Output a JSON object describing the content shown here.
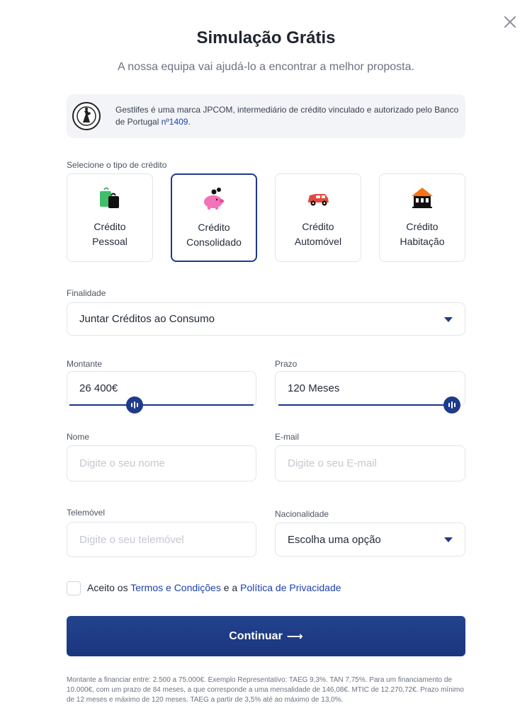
{
  "header": {
    "title": "Simulação Grátis",
    "subtitle": "A nossa equipa vai ajudá-lo a encontrar a melhor proposta."
  },
  "notice": {
    "text_before": "Gestlifes é uma marca JPCOM, intermediário de crédito vinculado e autorizado pelo Banco de Portugal ",
    "link": "nº1409",
    "text_after": "."
  },
  "credit_type": {
    "label": "Selecione o tipo de crédito",
    "options": [
      {
        "line1": "Crédito",
        "line2": "Pessoal",
        "icon": "shopping-bags-icon",
        "selected": false
      },
      {
        "line1": "Crédito",
        "line2": "Consolidado",
        "icon": "piggy-bank-icon",
        "selected": true
      },
      {
        "line1": "Crédito",
        "line2": "Automóvel",
        "icon": "car-icon",
        "selected": false
      },
      {
        "line1": "Crédito",
        "line2": "Habitação",
        "icon": "house-icon",
        "selected": false
      }
    ]
  },
  "finalidade": {
    "label": "Finalidade",
    "value": "Juntar Créditos ao Consumo"
  },
  "montante": {
    "label": "Montante",
    "value": "26 400€",
    "slider_fraction": 0.33
  },
  "prazo": {
    "label": "Prazo",
    "value": "120 Meses",
    "slider_fraction": 1.0
  },
  "nome": {
    "label": "Nome",
    "placeholder": "Digite o seu nome"
  },
  "email": {
    "label": "E-mail",
    "placeholder": "Digite o seu E-mail"
  },
  "telemovel": {
    "label": "Telemóvel",
    "placeholder": "Digite o seu telemóvel"
  },
  "nacionalidade": {
    "label": "Nacionalidade",
    "value": "Escolha uma opção"
  },
  "terms": {
    "prefix": "Aceito os ",
    "terms_link": "Termos e Condições",
    "middle": " e a ",
    "privacy_link": "Política de Privacidade",
    "checked": false
  },
  "submit": {
    "label": "Continuar",
    "arrow": "⟶"
  },
  "footer": {
    "text": "Montante a financiar entre: 2.500 a 75.000€. Exemplo Representativo: TAEG 9,3%. TAN 7,75%. Para um financiamento de 10.000€, com um prazo de 84 meses, a que corresponde a uma mensalidade de 146,08€. MTIC de 12.270,72€. Prazo mínimo de 12 meses e máximo de 120 meses. TAEG a partir de 3,5% até ao máximo de 13,0%."
  },
  "colors": {
    "primary": "#1e3a8a",
    "link": "#1e40af",
    "notice_bg": "#f3f4f7",
    "placeholder": "#c4c8cf"
  }
}
